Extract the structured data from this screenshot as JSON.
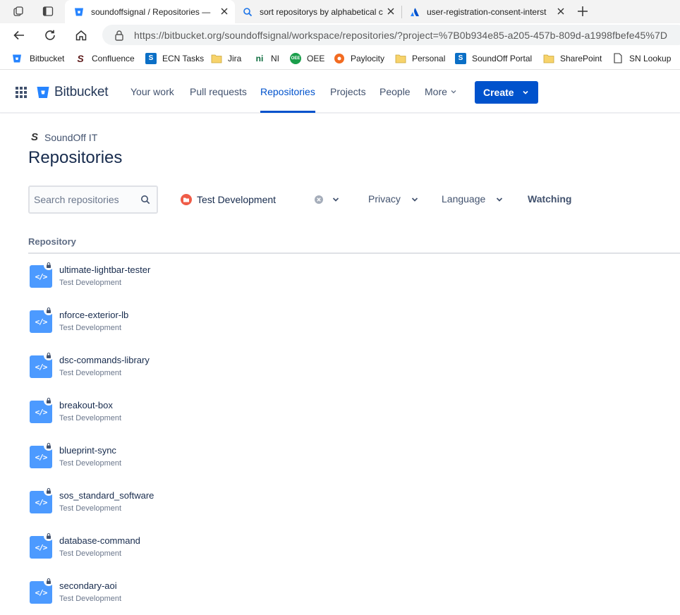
{
  "browser": {
    "tabs": [
      {
        "title": "soundoffsignal / Repositories —",
        "active": true,
        "favicon": "bitbucket-icon"
      },
      {
        "title": "sort repositorys by alphabetical c",
        "active": false,
        "favicon": "search-icon"
      },
      {
        "title": "user-registration-consent-interst",
        "active": false,
        "favicon": "atlassian-icon"
      }
    ],
    "url": "https://bitbucket.org/soundoffsignal/workspace/repositories/?project=%7B0b934e85-a205-457b-809d-a1998fbefe45%7D",
    "bookmarks": [
      {
        "label": "Bitbucket",
        "icon": "bitbucket-icon"
      },
      {
        "label": "Confluence",
        "icon": "soundoff-s-icon"
      },
      {
        "label": "ECN Tasks",
        "icon": "sharepoint-icon"
      },
      {
        "label": "Jira",
        "icon": "folder-icon"
      },
      {
        "label": "NI",
        "icon": "ni-icon"
      },
      {
        "label": "OEE",
        "icon": "oee-icon"
      },
      {
        "label": "Paylocity",
        "icon": "paylocity-icon"
      },
      {
        "label": "Personal",
        "icon": "folder-icon"
      },
      {
        "label": "SoundOff Portal",
        "icon": "sharepoint-icon"
      },
      {
        "label": "SharePoint",
        "icon": "folder-icon"
      },
      {
        "label": "SN Lookup",
        "icon": "page-icon"
      }
    ]
  },
  "header": {
    "logo": "Bitbucket",
    "nav": [
      "Your work",
      "Pull requests",
      "Repositories",
      "Projects",
      "People",
      "More"
    ],
    "active_nav": "Repositories",
    "create_label": "Create"
  },
  "page": {
    "workspace": "SoundOff IT",
    "title": "Repositories",
    "search_placeholder": "Search repositories",
    "project_filter": "Test Development",
    "filters": [
      "Privacy",
      "Language",
      "Watching"
    ],
    "column_header": "Repository"
  },
  "repositories": [
    {
      "name": "ultimate-lightbar-tester",
      "project": "Test Development"
    },
    {
      "name": "nforce-exterior-lb",
      "project": "Test Development"
    },
    {
      "name": "dsc-commands-library",
      "project": "Test Development"
    },
    {
      "name": "breakout-box",
      "project": "Test Development"
    },
    {
      "name": "blueprint-sync",
      "project": "Test Development"
    },
    {
      "name": "sos_standard_software",
      "project": "Test Development"
    },
    {
      "name": "database-command",
      "project": "Test Development"
    },
    {
      "name": "secondary-aoi",
      "project": "Test Development"
    }
  ],
  "colors": {
    "brand": "#0052cc",
    "repo_icon": "#4c9aff",
    "project_avatar": "#ef5c48"
  }
}
